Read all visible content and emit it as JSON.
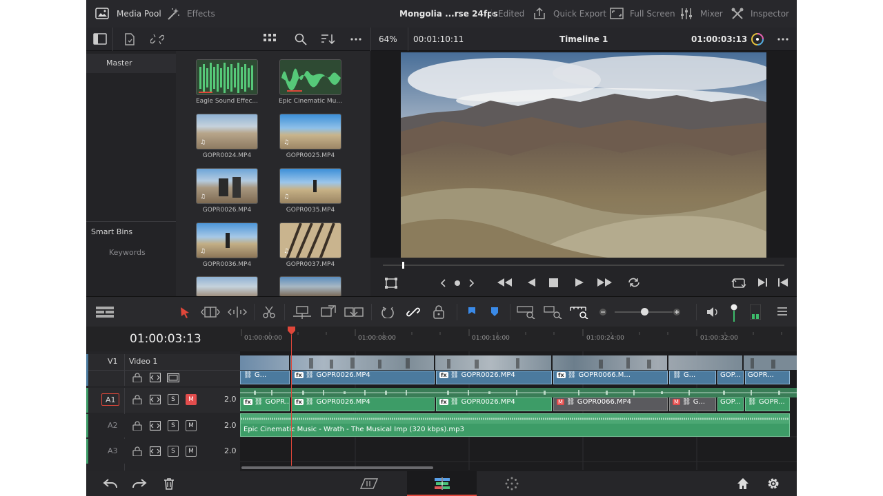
{
  "topbar": {
    "media_pool": "Media Pool",
    "effects": "Effects",
    "project_title": "Mongolia ...rse 24fps",
    "edited": "Edited",
    "quick_export": "Quick Export",
    "full_screen": "Full Screen",
    "mixer": "Mixer",
    "inspector": "Inspector"
  },
  "viewer_bar": {
    "zoom": "64%",
    "timecode": "00:01:10:11",
    "timeline_name": "Timeline 1",
    "current_tc": "01:00:03:13"
  },
  "bins": {
    "master": "Master",
    "smart_bins": "Smart Bins",
    "keywords": "Keywords"
  },
  "clips": [
    {
      "label": "Eagle Sound Effec..."
    },
    {
      "label": "Epic Cinematic Mu..."
    },
    {
      "label": "GOPR0024.MP4"
    },
    {
      "label": "GOPR0025.MP4"
    },
    {
      "label": "GOPR0026.MP4"
    },
    {
      "label": "GOPR0035.MP4"
    },
    {
      "label": "GOPR0036.MP4"
    },
    {
      "label": "GOPR0037.MP4"
    }
  ],
  "timeline": {
    "timecode": "01:00:03:13",
    "ruler": [
      "01:00:00:00",
      "01:00:08:00",
      "01:00:16:00",
      "01:00:24:00",
      "01:00:32:00"
    ],
    "tracks": {
      "v1_id": "V1",
      "v1_name": "Video 1",
      "a1_id": "A1",
      "a2_id": "A2",
      "a3_id": "A3",
      "solo": "S",
      "mute": "M",
      "a1_level": "2.0",
      "a2_level": "2.0",
      "a3_level": "2.0"
    },
    "video_clips": [
      "G...",
      "GOPR0026.MP4",
      "GOPR0026.MP4",
      "GOPR0066.M...",
      "G...",
      "GOP...",
      "GOPR..."
    ],
    "audio_clips": [
      "GOPR...",
      "GOPR0026.MP4",
      "GOPR0026.MP4",
      "GOPR0066.MP4",
      "G...",
      "GOP...",
      "GOPR..."
    ],
    "music": "Epic Cinematic Music - Wrath - The Musical Imp (320 kbps).mp3"
  },
  "colors": {
    "video_clip": "#4b7a9e",
    "audio_clip": "#3d9c67",
    "playhead": "#e0473a",
    "mute_active": "#e34d4d"
  }
}
